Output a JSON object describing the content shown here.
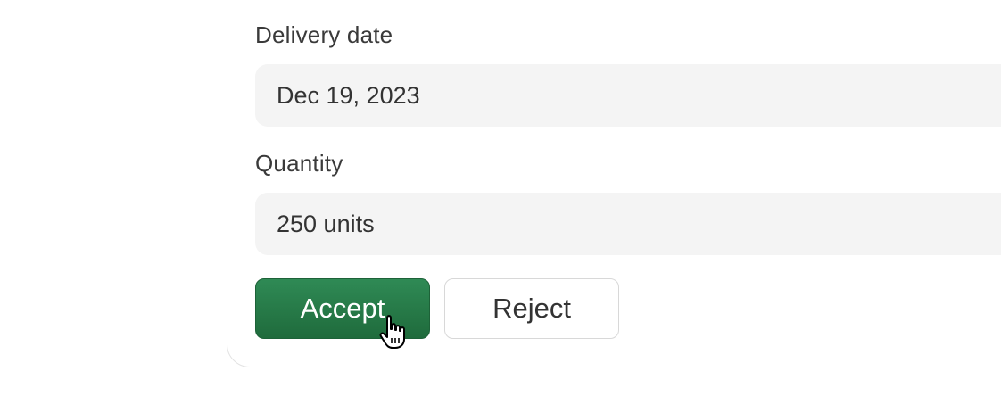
{
  "form": {
    "delivery_date": {
      "label": "Delivery date",
      "value": "Dec 19, 2023"
    },
    "quantity": {
      "label": "Quantity",
      "value": "250 units"
    }
  },
  "actions": {
    "accept_label": "Accept",
    "reject_label": "Reject"
  },
  "colors": {
    "accept_bg": "#2a7c4a",
    "field_bg": "#f4f4f4",
    "card_border": "#e2e2e2"
  },
  "icons": {
    "cursor": "hand-pointer-icon"
  }
}
